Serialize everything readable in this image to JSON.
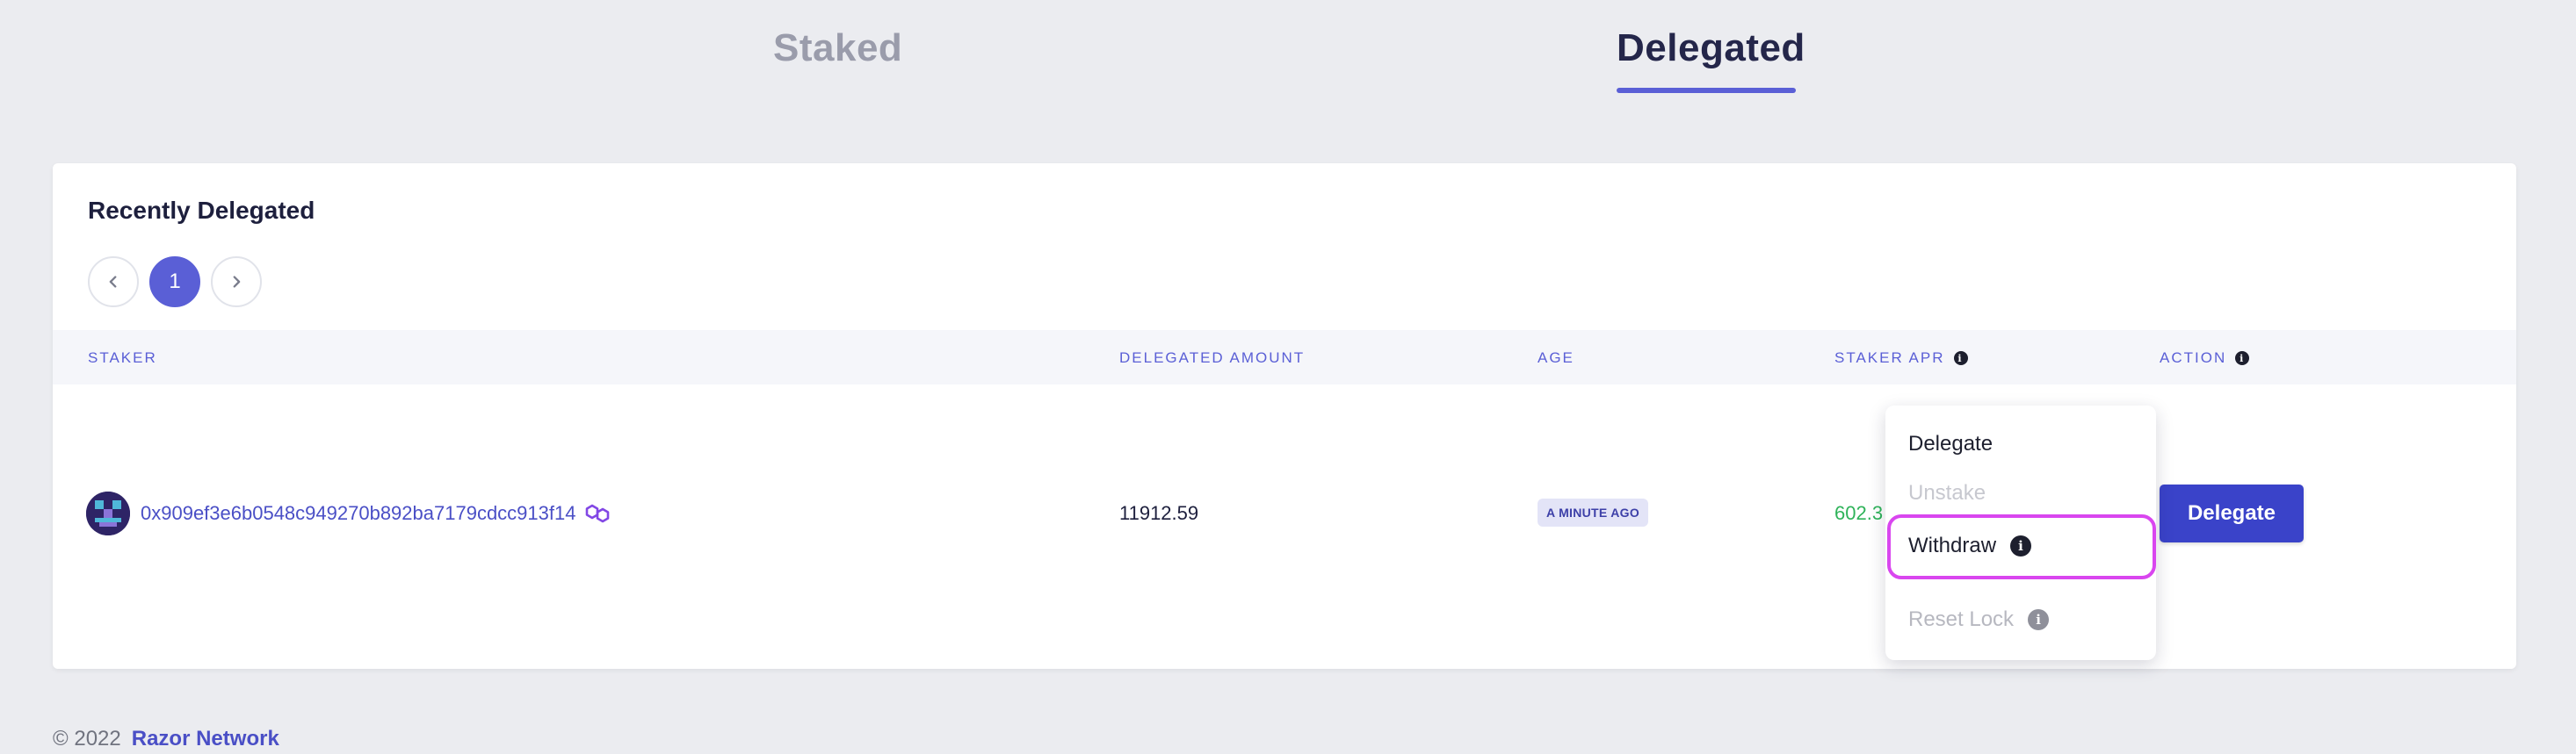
{
  "tabs": [
    {
      "label": "Staked"
    },
    {
      "label": "Delegated"
    }
  ],
  "card": {
    "title": "Recently Delegated",
    "pagination": {
      "current": "1"
    }
  },
  "table": {
    "headers": {
      "staker": "STAKER",
      "delegated_amount": "DELEGATED AMOUNT",
      "age": "AGE",
      "staker_apr": "STAKER APR",
      "action": "ACTION"
    },
    "rows": [
      {
        "staker": "0x909ef3e6b0548c949270b892ba7179cdcc913f14",
        "delegated_amount": "11912.59",
        "age": "A MINUTE AGO",
        "staker_apr": "602.3",
        "action_label": "Delegate"
      }
    ]
  },
  "dropdown": {
    "items": [
      {
        "label": "Delegate",
        "enabled": true
      },
      {
        "label": "Unstake",
        "enabled": false
      },
      {
        "label": "Withdraw",
        "enabled": true,
        "highlighted": true
      },
      {
        "label": "Reset Lock",
        "enabled": false
      }
    ]
  },
  "footer": {
    "copyright": "© 2022",
    "brand": "Razor Network"
  },
  "colors": {
    "accent": "#5a5fd6",
    "highlight": "#d946ef",
    "apr": "#2fb35a"
  },
  "icons": {
    "info": "info-icon",
    "chain": "polygon-icon",
    "prev": "chevron-left-icon",
    "next": "chevron-right-icon"
  }
}
